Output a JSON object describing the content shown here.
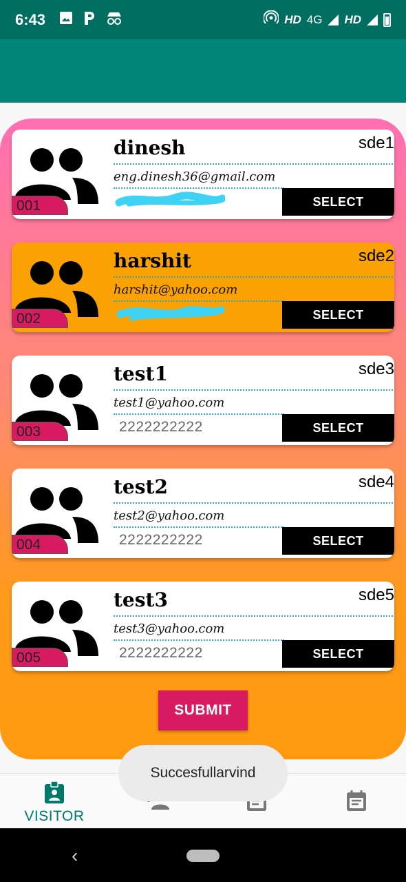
{
  "status_bar": {
    "time": "6:43",
    "network_left": "HD",
    "network_type": "4G",
    "network_right": "HD",
    "icons": [
      "image-icon",
      "parking-icon",
      "incognito-icon",
      "hotspot-icon",
      "signal-icon",
      "battery-icon"
    ]
  },
  "cards": [
    {
      "id": "001",
      "name": "dinesh",
      "code": "sde1",
      "email": "eng.dinesh36@gmail.com",
      "phone": "",
      "selected": false,
      "button": "SELECT"
    },
    {
      "id": "002",
      "name": "harshit",
      "code": "sde2",
      "email": "harshit@yahoo.com",
      "phone": "",
      "selected": true,
      "button": "SELECT"
    },
    {
      "id": "003",
      "name": "test1",
      "code": "sde3",
      "email": "test1@yahoo.com",
      "phone": "2222222222",
      "selected": false,
      "button": "SELECT"
    },
    {
      "id": "004",
      "name": "test2",
      "code": "sde4",
      "email": "test2@yahoo.com",
      "phone": "2222222222",
      "selected": false,
      "button": "SELECT"
    },
    {
      "id": "005",
      "name": "test3",
      "code": "sde5",
      "email": "test3@yahoo.com",
      "phone": "2222222222",
      "selected": false,
      "button": "SELECT"
    }
  ],
  "submit_label": "SUBMIT",
  "toast": "Succesfullarvind",
  "bottom_nav": {
    "items": [
      {
        "label": "VISITOR",
        "icon": "badge-icon",
        "active": true
      },
      {
        "label": "",
        "icon": "add-person-icon",
        "active": false
      },
      {
        "label": "",
        "icon": "calendar-icon",
        "active": false
      },
      {
        "label": "",
        "icon": "calendar-icon",
        "active": false
      }
    ]
  },
  "colors": {
    "status_bar": "#006e60",
    "app_bar": "#008578",
    "accent_pink": "#d81b60",
    "selected_card": "#f9a202",
    "nav_active": "#00796b"
  }
}
